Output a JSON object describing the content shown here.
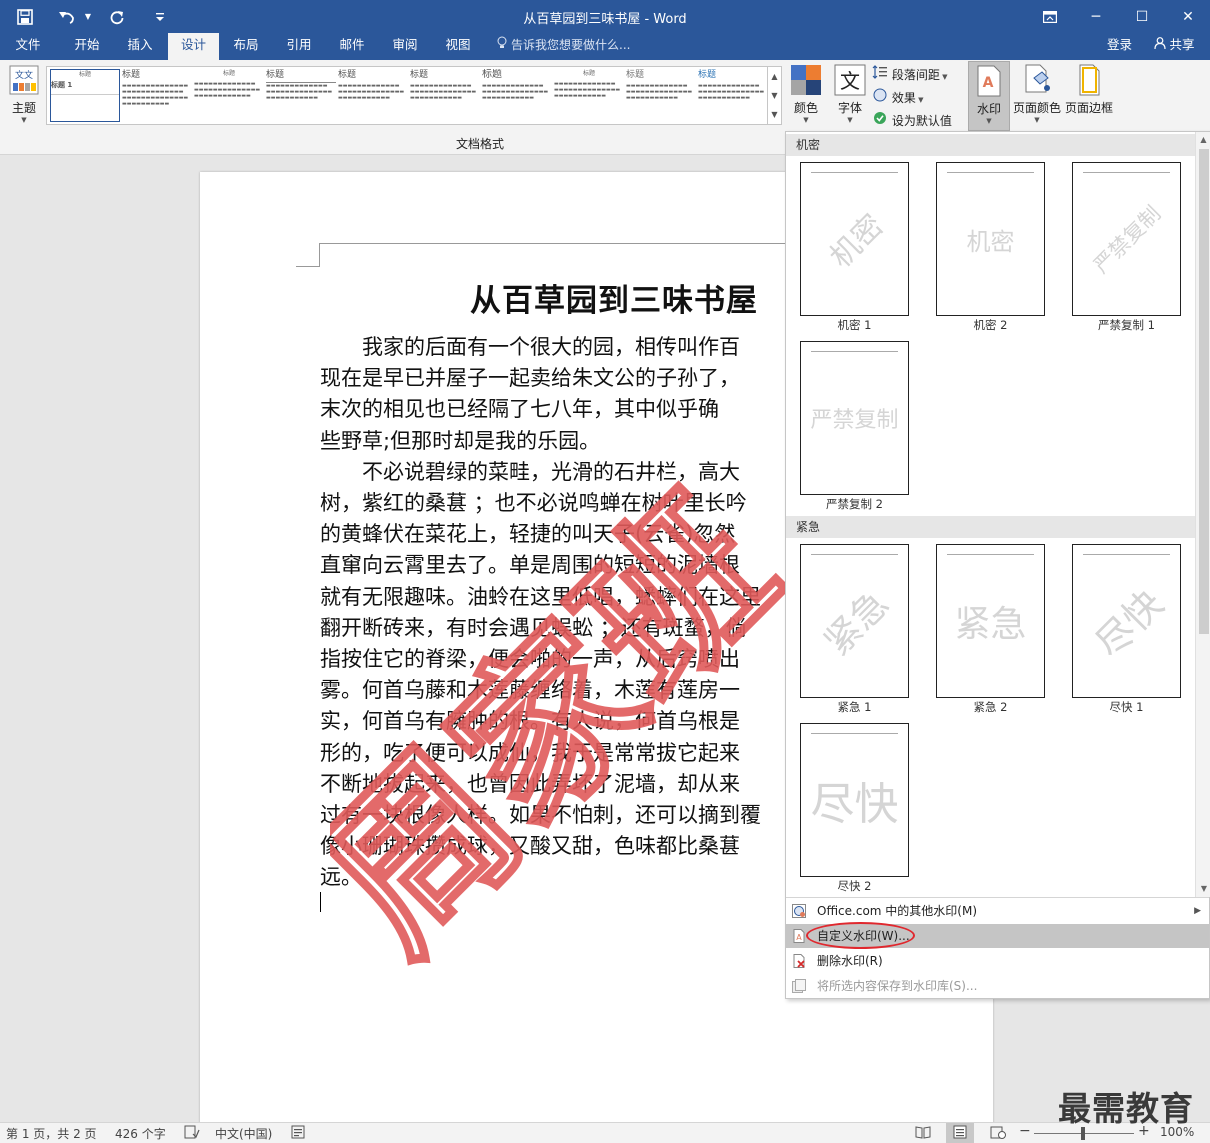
{
  "titlebar": {
    "title": "从百草园到三味书屋 - Word",
    "save_icon": "save-icon",
    "undo_icon": "undo-icon",
    "redo_icon": "redo-icon",
    "customize_icon": "customize-quick-access-icon",
    "restore_icon": "ribbon-display-icon",
    "minimize_glyph": "─",
    "maximize_glyph": "☐",
    "close_glyph": "✕"
  },
  "tabs": {
    "items": [
      "文件",
      "开始",
      "插入",
      "设计",
      "布局",
      "引用",
      "邮件",
      "审阅",
      "视图"
    ],
    "active": "设计",
    "tell_me": "告诉我您想要做什么...",
    "signin": "登录",
    "share": "共享"
  },
  "ribbon": {
    "theme_label": "主题",
    "gallery_title": "标题",
    "gallery_heading": "标题 1",
    "gallery_group_label": "文档格式",
    "colors_label": "颜色",
    "fonts_label": "字体",
    "paragraph_spacing": "段落间距",
    "effects": "效果",
    "set_default": "设为默认值",
    "watermark_label": "水印",
    "page_color_label": "页面颜色",
    "page_border_label": "页面边框"
  },
  "document": {
    "title": "从百草园到三味书屋",
    "lines": [
      "　　我家的后面有一个很大的园，相传叫作百",
      "现在是早已并屋子一起卖给朱文公的子孙了，",
      "末次的相见也已经隔了七八年，其中似乎确",
      "些野草;但那时却是我的乐园。",
      "　　不必说碧绿的菜畦，光滑的石井栏，高大",
      "树，紫红的桑葚 ；也不必说鸣蝉在树叶里长吟",
      "的黄蜂伏在菜花上，轻捷的叫天子(云雀)忽然",
      "直窜向云霄里去了。单是周围的短短的泥墙根",
      "就有无限趣味。油蛉在这里低唱，蟋蟀们在这里",
      "翻开断砖来，有时会遇见蜈蚣 ；还有斑蝥，倘",
      "指按住它的脊梁，便会啪的一声，从后窍喷出",
      "雾。何首乌藤和木莲藤缠络着，木莲有莲房一",
      "实，何首乌有臃肿的根。有人说，何首乌根是",
      "形的，吃了便可以成仙，我于是常常拔它起来",
      "不断地拔起来，也曾因此弄坏了泥墙，却从来",
      "过有一块根像人样。如果不怕刺，还可以摘到覆",
      "像小珊瑚珠攒成球，又酸又甜，色味都比桑葚",
      "远。"
    ],
    "stamp_text": "周家班"
  },
  "watermark_menu": {
    "section1": "机密",
    "section2": "紧急",
    "thumbs": [
      {
        "caption": "机密 1",
        "wm": "机密"
      },
      {
        "caption": "机密 2",
        "wm": "机密"
      },
      {
        "caption": "严禁复制 1",
        "wm": "严禁复制"
      },
      {
        "caption": "严禁复制 2",
        "wm": "严禁复制"
      },
      {
        "caption": "紧急 1",
        "wm": "紧急"
      },
      {
        "caption": "紧急 2",
        "wm": "紧急"
      },
      {
        "caption": "尽快 1",
        "wm": "尽快"
      },
      {
        "caption": "尽快 2",
        "wm": "尽快"
      }
    ],
    "items": {
      "more": "Office.com 中的其他水印(M)",
      "custom": "自定义水印(W)...",
      "remove": "删除水印(R)",
      "save": "将所选内容保存到水印库(S)..."
    },
    "highlight_color": "#e0282e"
  },
  "status": {
    "page": "第 1 页，共 2 页",
    "words": "426 个字",
    "lang": "中文(中国)",
    "zoom": "100%"
  },
  "brand": "最需教育",
  "colors": {
    "word_blue": "#2b579a",
    "stamp": "#e05a5a",
    "ribbon_bg": "#f3f3f3"
  }
}
